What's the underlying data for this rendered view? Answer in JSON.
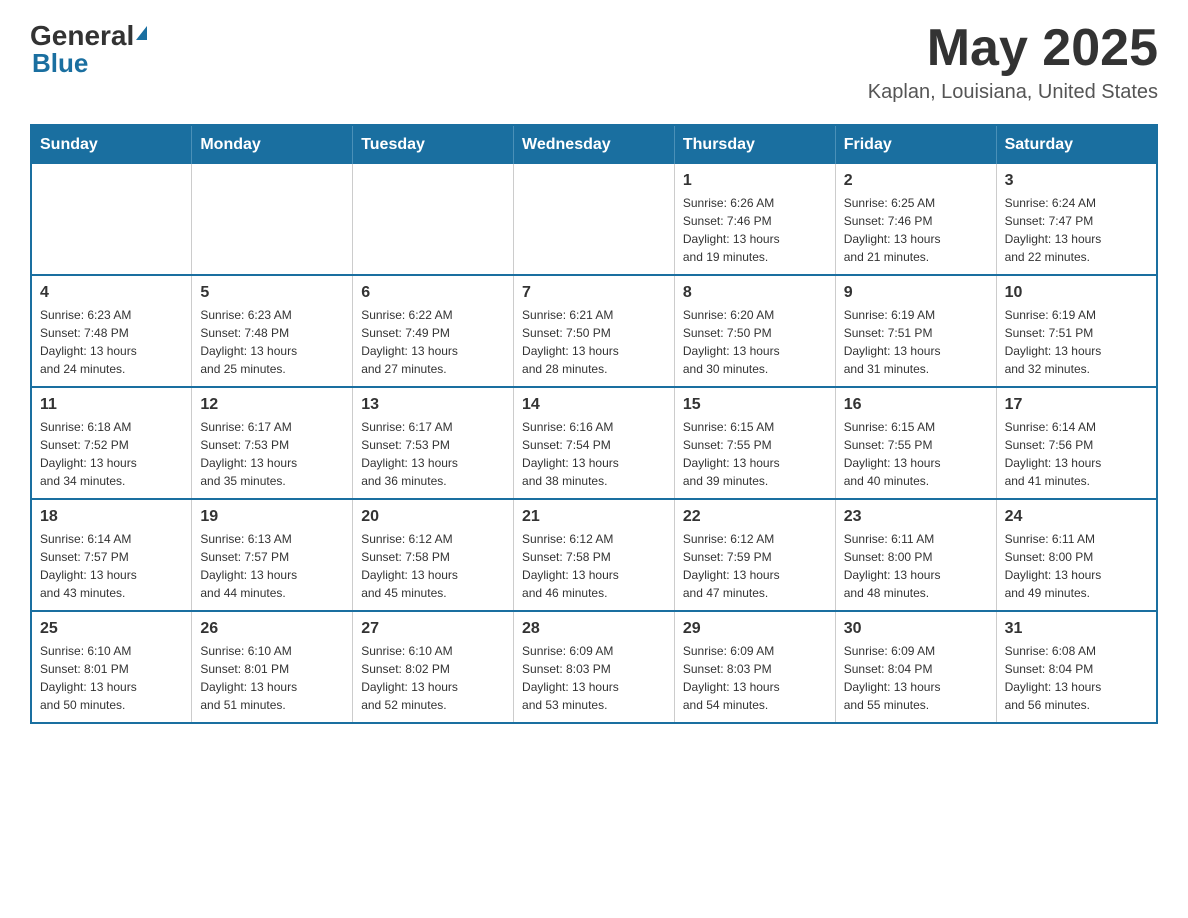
{
  "header": {
    "logo_general": "General",
    "logo_blue": "Blue",
    "month_title": "May 2025",
    "location": "Kaplan, Louisiana, United States"
  },
  "days_of_week": [
    "Sunday",
    "Monday",
    "Tuesday",
    "Wednesday",
    "Thursday",
    "Friday",
    "Saturday"
  ],
  "weeks": [
    [
      {
        "day": "",
        "info": ""
      },
      {
        "day": "",
        "info": ""
      },
      {
        "day": "",
        "info": ""
      },
      {
        "day": "",
        "info": ""
      },
      {
        "day": "1",
        "info": "Sunrise: 6:26 AM\nSunset: 7:46 PM\nDaylight: 13 hours\nand 19 minutes."
      },
      {
        "day": "2",
        "info": "Sunrise: 6:25 AM\nSunset: 7:46 PM\nDaylight: 13 hours\nand 21 minutes."
      },
      {
        "day": "3",
        "info": "Sunrise: 6:24 AM\nSunset: 7:47 PM\nDaylight: 13 hours\nand 22 minutes."
      }
    ],
    [
      {
        "day": "4",
        "info": "Sunrise: 6:23 AM\nSunset: 7:48 PM\nDaylight: 13 hours\nand 24 minutes."
      },
      {
        "day": "5",
        "info": "Sunrise: 6:23 AM\nSunset: 7:48 PM\nDaylight: 13 hours\nand 25 minutes."
      },
      {
        "day": "6",
        "info": "Sunrise: 6:22 AM\nSunset: 7:49 PM\nDaylight: 13 hours\nand 27 minutes."
      },
      {
        "day": "7",
        "info": "Sunrise: 6:21 AM\nSunset: 7:50 PM\nDaylight: 13 hours\nand 28 minutes."
      },
      {
        "day": "8",
        "info": "Sunrise: 6:20 AM\nSunset: 7:50 PM\nDaylight: 13 hours\nand 30 minutes."
      },
      {
        "day": "9",
        "info": "Sunrise: 6:19 AM\nSunset: 7:51 PM\nDaylight: 13 hours\nand 31 minutes."
      },
      {
        "day": "10",
        "info": "Sunrise: 6:19 AM\nSunset: 7:51 PM\nDaylight: 13 hours\nand 32 minutes."
      }
    ],
    [
      {
        "day": "11",
        "info": "Sunrise: 6:18 AM\nSunset: 7:52 PM\nDaylight: 13 hours\nand 34 minutes."
      },
      {
        "day": "12",
        "info": "Sunrise: 6:17 AM\nSunset: 7:53 PM\nDaylight: 13 hours\nand 35 minutes."
      },
      {
        "day": "13",
        "info": "Sunrise: 6:17 AM\nSunset: 7:53 PM\nDaylight: 13 hours\nand 36 minutes."
      },
      {
        "day": "14",
        "info": "Sunrise: 6:16 AM\nSunset: 7:54 PM\nDaylight: 13 hours\nand 38 minutes."
      },
      {
        "day": "15",
        "info": "Sunrise: 6:15 AM\nSunset: 7:55 PM\nDaylight: 13 hours\nand 39 minutes."
      },
      {
        "day": "16",
        "info": "Sunrise: 6:15 AM\nSunset: 7:55 PM\nDaylight: 13 hours\nand 40 minutes."
      },
      {
        "day": "17",
        "info": "Sunrise: 6:14 AM\nSunset: 7:56 PM\nDaylight: 13 hours\nand 41 minutes."
      }
    ],
    [
      {
        "day": "18",
        "info": "Sunrise: 6:14 AM\nSunset: 7:57 PM\nDaylight: 13 hours\nand 43 minutes."
      },
      {
        "day": "19",
        "info": "Sunrise: 6:13 AM\nSunset: 7:57 PM\nDaylight: 13 hours\nand 44 minutes."
      },
      {
        "day": "20",
        "info": "Sunrise: 6:12 AM\nSunset: 7:58 PM\nDaylight: 13 hours\nand 45 minutes."
      },
      {
        "day": "21",
        "info": "Sunrise: 6:12 AM\nSunset: 7:58 PM\nDaylight: 13 hours\nand 46 minutes."
      },
      {
        "day": "22",
        "info": "Sunrise: 6:12 AM\nSunset: 7:59 PM\nDaylight: 13 hours\nand 47 minutes."
      },
      {
        "day": "23",
        "info": "Sunrise: 6:11 AM\nSunset: 8:00 PM\nDaylight: 13 hours\nand 48 minutes."
      },
      {
        "day": "24",
        "info": "Sunrise: 6:11 AM\nSunset: 8:00 PM\nDaylight: 13 hours\nand 49 minutes."
      }
    ],
    [
      {
        "day": "25",
        "info": "Sunrise: 6:10 AM\nSunset: 8:01 PM\nDaylight: 13 hours\nand 50 minutes."
      },
      {
        "day": "26",
        "info": "Sunrise: 6:10 AM\nSunset: 8:01 PM\nDaylight: 13 hours\nand 51 minutes."
      },
      {
        "day": "27",
        "info": "Sunrise: 6:10 AM\nSunset: 8:02 PM\nDaylight: 13 hours\nand 52 minutes."
      },
      {
        "day": "28",
        "info": "Sunrise: 6:09 AM\nSunset: 8:03 PM\nDaylight: 13 hours\nand 53 minutes."
      },
      {
        "day": "29",
        "info": "Sunrise: 6:09 AM\nSunset: 8:03 PM\nDaylight: 13 hours\nand 54 minutes."
      },
      {
        "day": "30",
        "info": "Sunrise: 6:09 AM\nSunset: 8:04 PM\nDaylight: 13 hours\nand 55 minutes."
      },
      {
        "day": "31",
        "info": "Sunrise: 6:08 AM\nSunset: 8:04 PM\nDaylight: 13 hours\nand 56 minutes."
      }
    ]
  ]
}
